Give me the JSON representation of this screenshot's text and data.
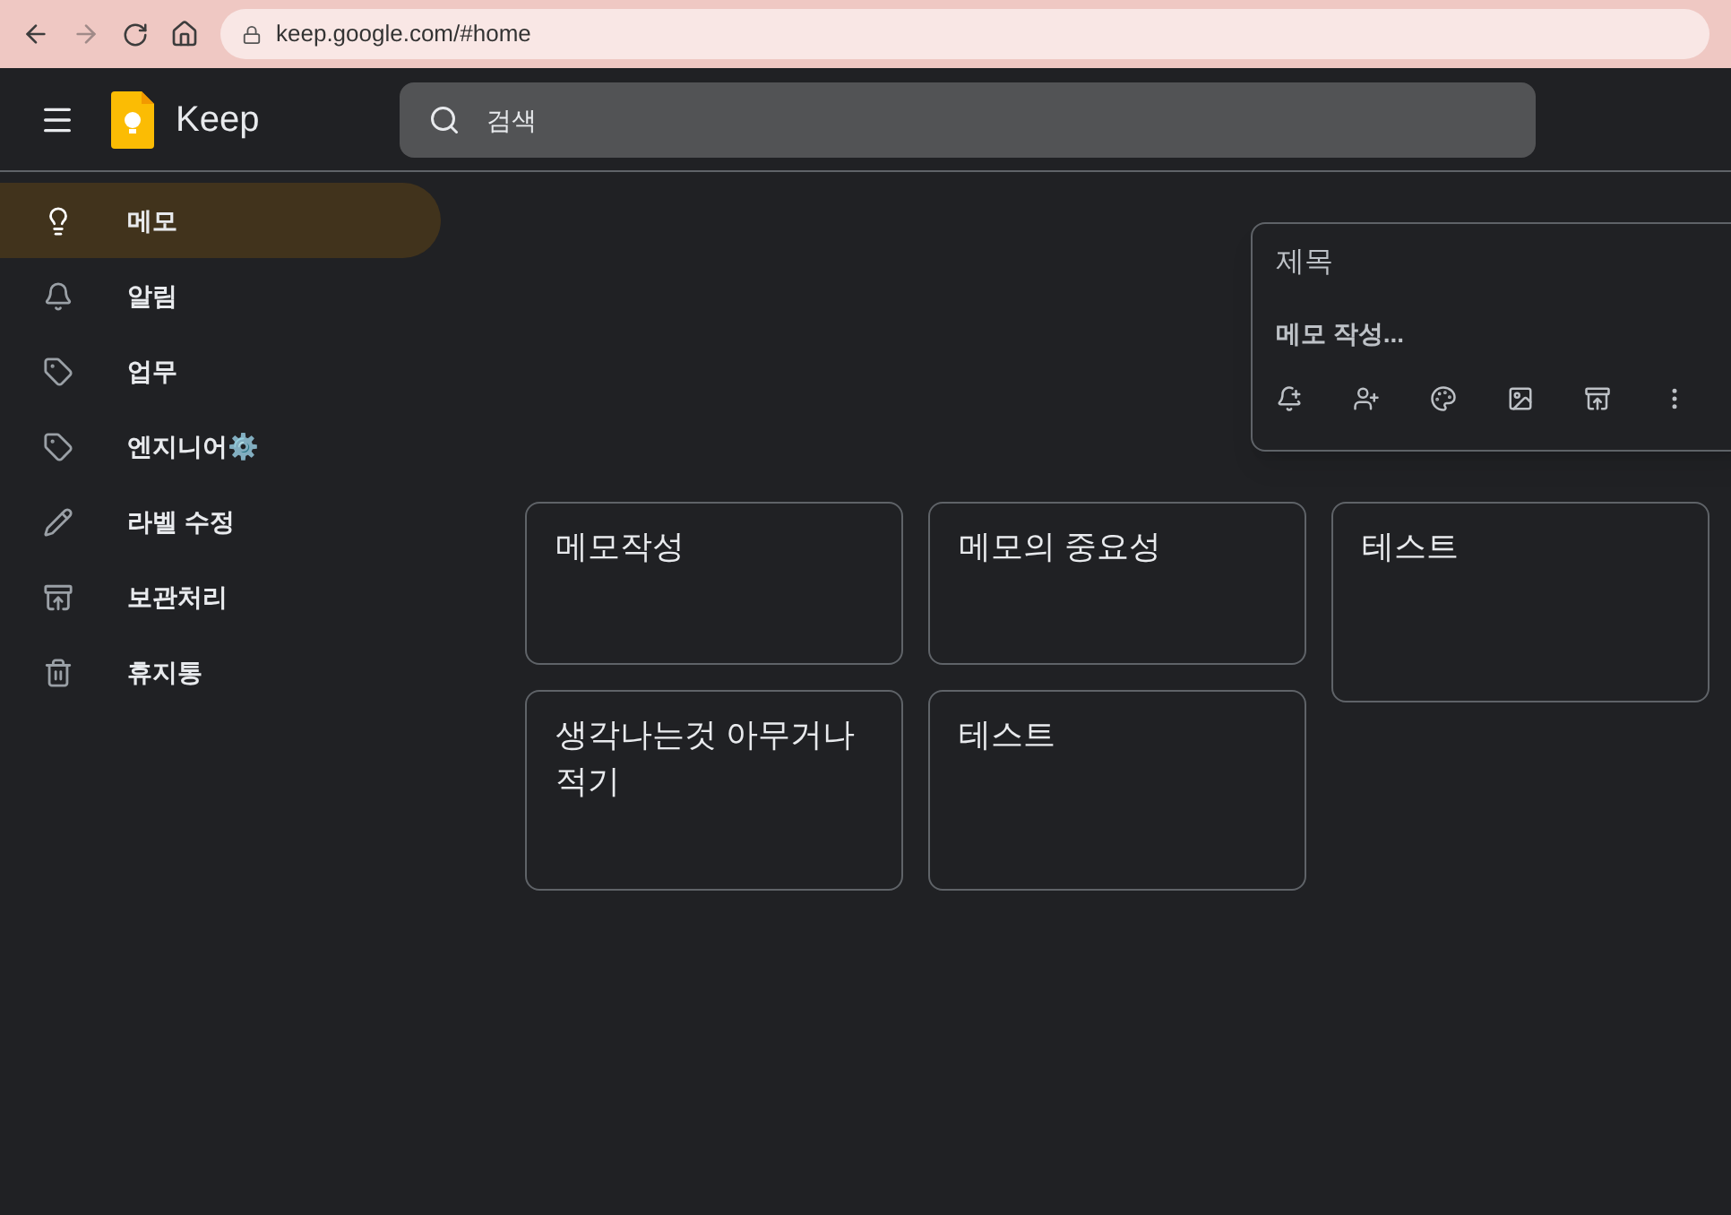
{
  "browser": {
    "url": "keep.google.com/#home"
  },
  "app": {
    "name": "Keep",
    "search_placeholder": "검색"
  },
  "sidebar": {
    "items": [
      {
        "label": "메모",
        "kind": "bulb",
        "selected": true
      },
      {
        "label": "알림",
        "kind": "bell",
        "selected": false
      },
      {
        "label": "업무",
        "kind": "label",
        "selected": false
      },
      {
        "label": "엔지니어⚙️",
        "kind": "label",
        "selected": false
      },
      {
        "label": "라벨 수정",
        "kind": "pencil",
        "selected": false
      },
      {
        "label": "보관처리",
        "kind": "archive",
        "selected": false
      },
      {
        "label": "휴지통",
        "kind": "trash",
        "selected": false
      }
    ]
  },
  "take_note": {
    "title_placeholder": "제목",
    "body_placeholder": "메모 작성..."
  },
  "note_columns": [
    {
      "notes": [
        {
          "title": "메모작성"
        },
        {
          "title": "생각나는것 아무거나 적기"
        }
      ]
    },
    {
      "notes": [
        {
          "title": "메모의 중요성"
        },
        {
          "title": "테스트"
        }
      ]
    },
    {
      "notes": [
        {
          "title": "테스트"
        }
      ]
    }
  ]
}
